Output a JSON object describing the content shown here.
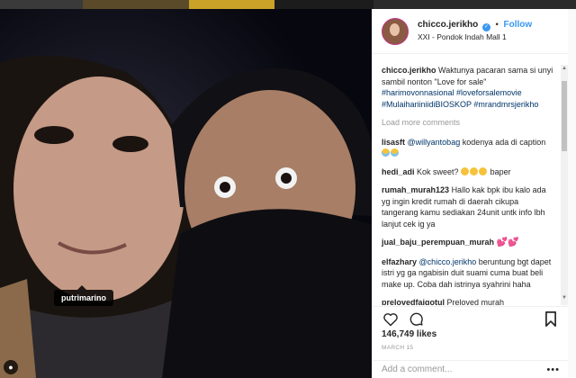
{
  "post": {
    "photo_tag": "putrimarino",
    "header": {
      "username": "chicco.jerikho",
      "follow_label": "Follow",
      "location": "XXI - Pondok Indah Mall 1"
    },
    "caption": {
      "username": "chicco.jerikho",
      "text": "Waktunya pacaran sama si unyi sambil nonton \"Love for sale\" ",
      "hashtags": "#harimovonnasional #loveforsalemovie #MulaihariiniidiBIOSKOP #mrandmrsjerikho"
    },
    "load_more_label": "Load more comments",
    "comments": [
      {
        "username": "lisasft",
        "mention": "@willyantobag",
        "text": " kodenya ada di caption "
      },
      {
        "username": "hedi_adi",
        "text": "Kok sweet? ",
        "after": " baper"
      },
      {
        "username": "rumah_murah123",
        "text": "Hallo kak bpk ibu kalo ada yg ingin kredit rumah di daerah cikupa tangerang kamu sediakan 24unit untk info lbh lanjut cek ig ya"
      },
      {
        "username": "jual_baju_perempuan_murah",
        "text": "💕💕"
      },
      {
        "username": "elfazhary",
        "mention": "@chicco.jerikho",
        "text": " beruntung bgt dapet istri yg ga ngabisin duit suami cuma buat beli make up. Coba dah istrinya syahrini haha"
      },
      {
        "username": "prelovedfaiqotul",
        "text": "Preloved murah"
      }
    ],
    "likes": "146,749 likes",
    "date": "MARCH 15",
    "add_comment_placeholder": "Add a comment...",
    "more_label": "•••"
  },
  "icons": [
    "heart-icon",
    "comment-icon",
    "bookmark-icon",
    "user-tag-icon",
    "verified-badge-icon"
  ],
  "colors": {
    "link": "#3897f0",
    "hashtag": "#003569",
    "border": "#efefef"
  }
}
